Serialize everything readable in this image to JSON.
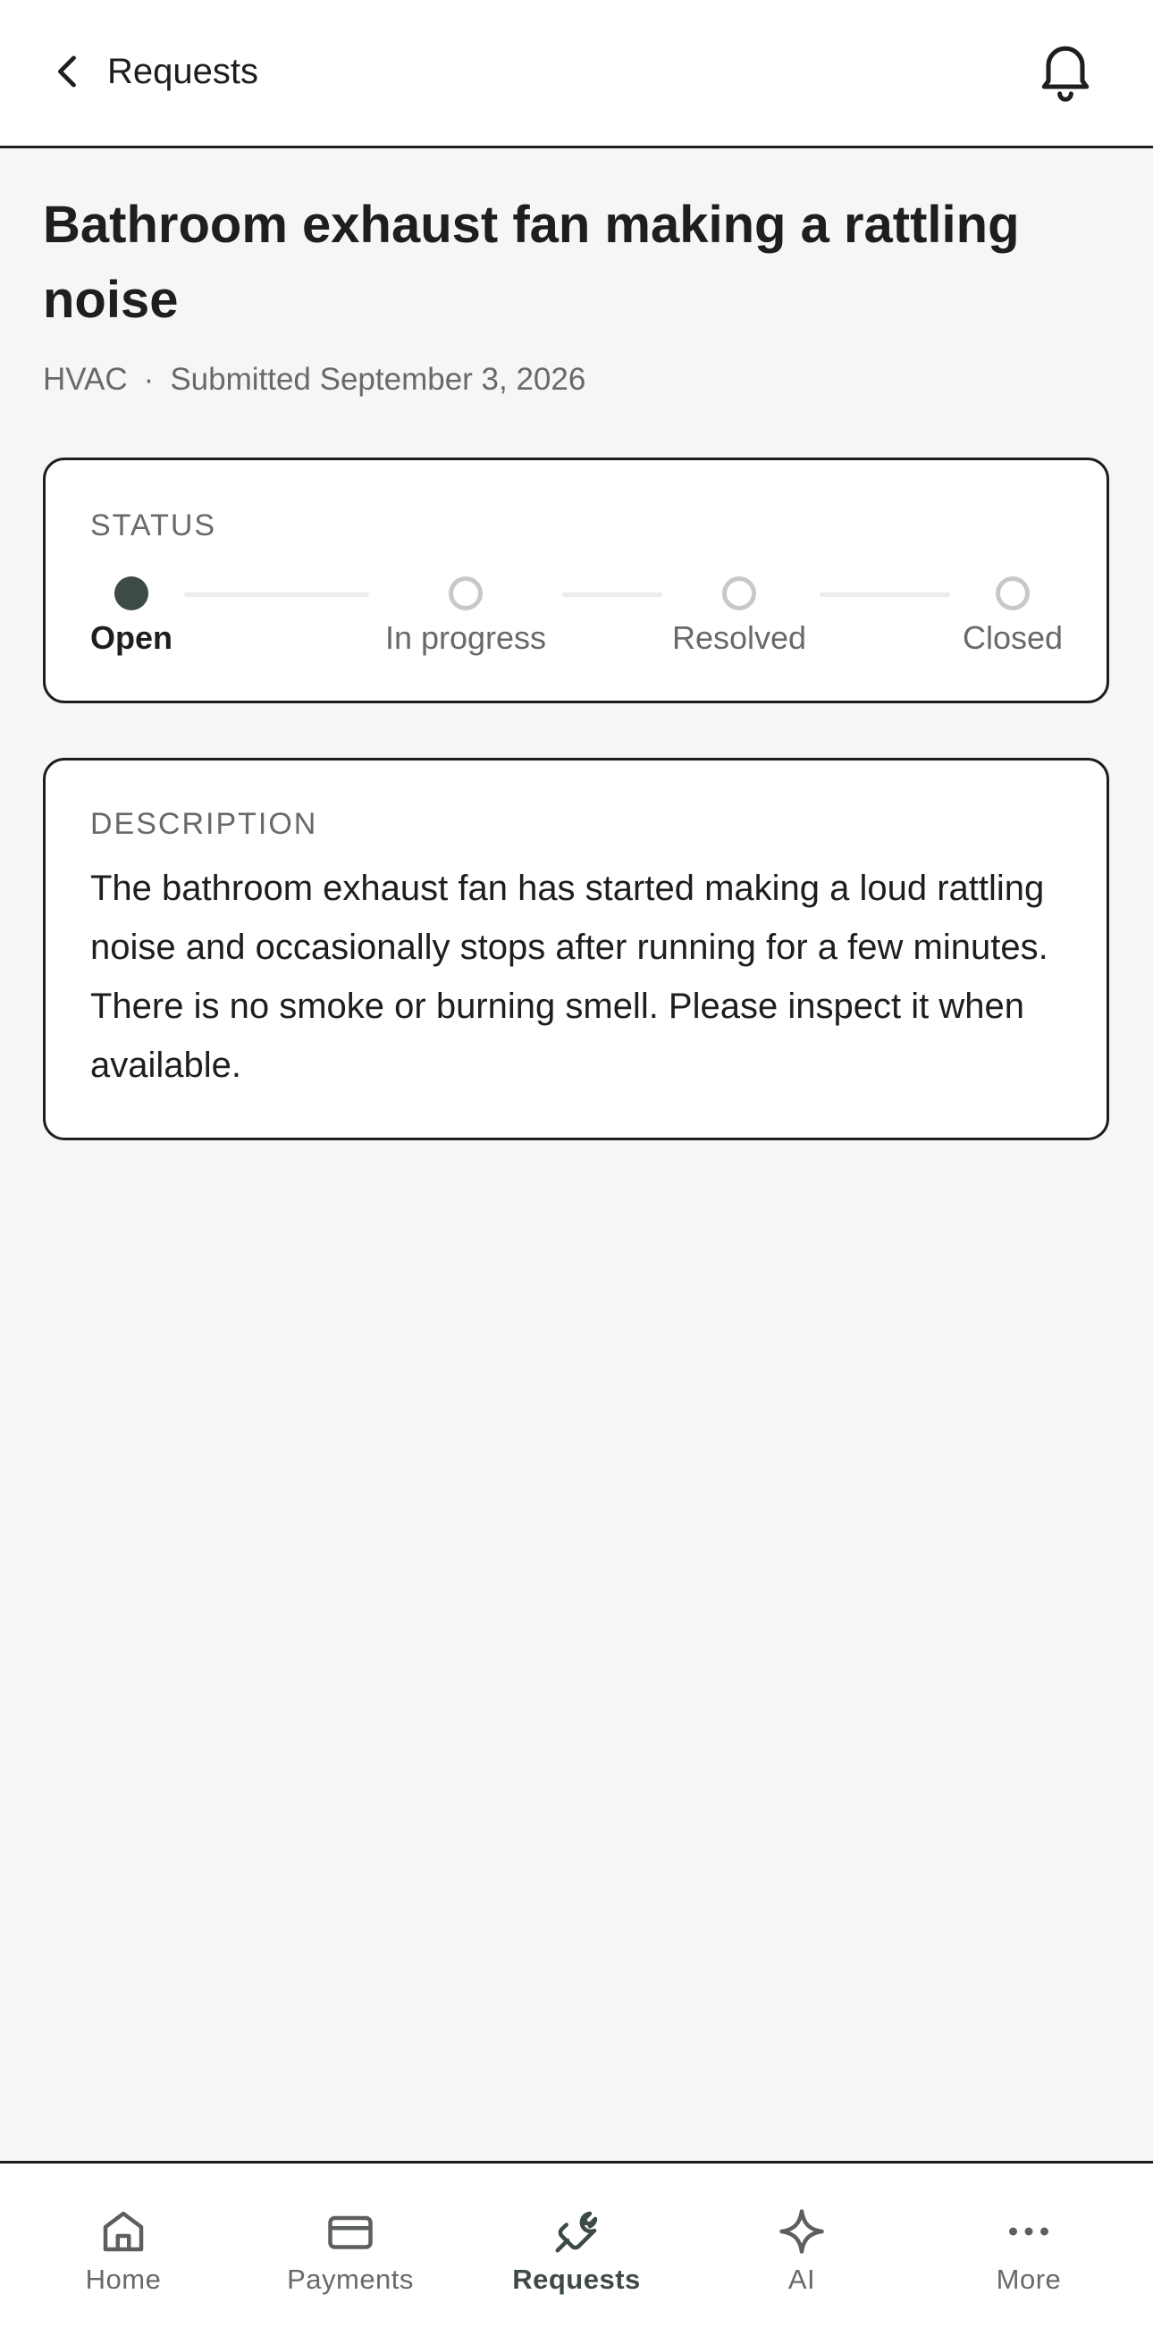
{
  "header": {
    "back_label": "Requests"
  },
  "request": {
    "title": "Bathroom exhaust fan making a rattling noise",
    "category": "HVAC",
    "separator": "·",
    "submitted": "Submitted September 3, 2026"
  },
  "status": {
    "label": "STATUS",
    "steps": [
      {
        "label": "Open",
        "active": true
      },
      {
        "label": "In progress",
        "active": false
      },
      {
        "label": "Resolved",
        "active": false
      },
      {
        "label": "Closed",
        "active": false
      }
    ]
  },
  "description": {
    "label": "DESCRIPTION",
    "text": "The bathroom exhaust fan has started making a loud rattling noise and occasionally stops after running for a few minutes. There is no smoke or burning smell. Please inspect it when available."
  },
  "tabs": [
    {
      "label": "Home",
      "icon": "home-icon",
      "active": false
    },
    {
      "label": "Payments",
      "icon": "credit-card-icon",
      "active": false
    },
    {
      "label": "Requests",
      "icon": "wrench-icon",
      "active": true
    },
    {
      "label": "AI",
      "icon": "sparkle-icon",
      "active": false
    },
    {
      "label": "More",
      "icon": "more-icon",
      "active": false
    }
  ],
  "colors": {
    "accent": "#3d4a45",
    "background": "#f6f6f5",
    "muted_text": "#666a68",
    "border": "#1c1f1e"
  }
}
